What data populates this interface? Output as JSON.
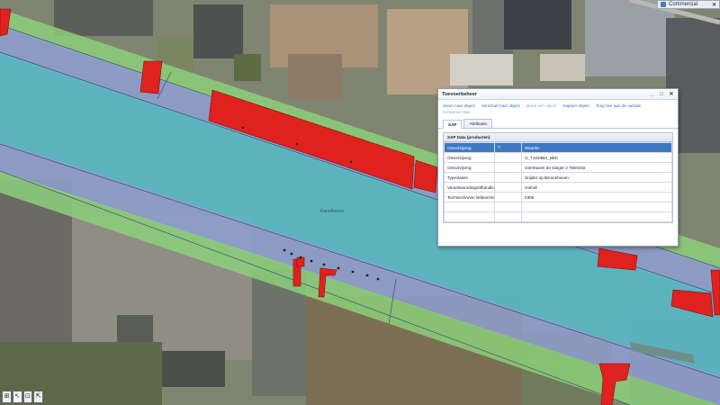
{
  "app": {
    "topbar_label": "Commercial",
    "topbar_close": "✕"
  },
  "map": {
    "center_label": "Kanalhaven"
  },
  "panel": {
    "title": "Toevoerbeheer",
    "window_buttons": [
      "_",
      "□",
      "✕"
    ],
    "links": [
      {
        "label": "Zoom naar object",
        "enabled": true
      },
      {
        "label": "Verschuif naar object",
        "enabled": true
      },
      {
        "label": "Maak een object",
        "enabled": false
      },
      {
        "label": "Kopieer object",
        "enabled": true
      },
      {
        "label": "Toog hier aan de outside",
        "enabled": true
      },
      {
        "label": "Schermen sluit",
        "enabled": false
      }
    ],
    "tabs": [
      {
        "label": "SAP",
        "active": true
      },
      {
        "label": "Attributen",
        "active": false
      }
    ],
    "section_title": "SAP Data (producten)",
    "table": {
      "headers": [
        "Omschrijving",
        "",
        "Waarde"
      ],
      "rows": [
        [
          "Omschrijving",
          "",
          "G_T1033BS_BEK"
        ],
        [
          "Omschrijving",
          "",
          "Gemhaven 3e stieger 2 T8E0342"
        ],
        [
          "Typeclasse",
          "",
          "Snijder op Binnenhaven"
        ],
        [
          "Verantwoordingsafhandle",
          "",
          "Geïndl"
        ],
        [
          "Technisch/over liefdeschef",
          "",
          "0305"
        ],
        [
          "",
          "",
          ""
        ],
        [
          "",
          "",
          ""
        ]
      ]
    }
  },
  "tools": [
    "⊞",
    "↖",
    "⊡",
    "⇱"
  ],
  "colors": {
    "water": "#5ab8c5",
    "quay": "#8f9fd0",
    "bank": "#8ccf7a",
    "highlight": "#e0221e",
    "panel_header": "#3c79c2"
  }
}
